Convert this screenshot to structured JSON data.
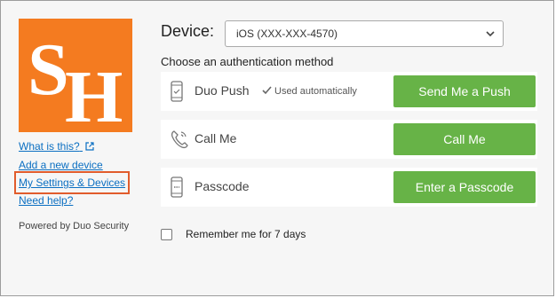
{
  "logo": {
    "letters": "SH",
    "color": "#f47b20"
  },
  "links": {
    "what_is_this": "What is this?",
    "add_device": "Add a new device",
    "my_settings": "My Settings & Devices",
    "need_help": "Need help?"
  },
  "powered_by": "Powered by Duo Security",
  "device": {
    "label": "Device:",
    "selected": "iOS (XXX-XXX-4570)"
  },
  "choose_method": "Choose an authentication method",
  "methods": [
    {
      "label": "Duo Push",
      "note": "Used automatically",
      "button": "Send Me a Push",
      "icon": "phone-icon"
    },
    {
      "label": "Call Me",
      "button": "Call Me",
      "icon": "phone-call-icon"
    },
    {
      "label": "Passcode",
      "button": "Enter a Passcode",
      "icon": "passcode-icon"
    }
  ],
  "remember": {
    "label": "Remember me for 7 days",
    "checked": false
  },
  "colors": {
    "button": "#67b347",
    "link": "#0b6fc2",
    "highlight": "#e15c2c"
  }
}
